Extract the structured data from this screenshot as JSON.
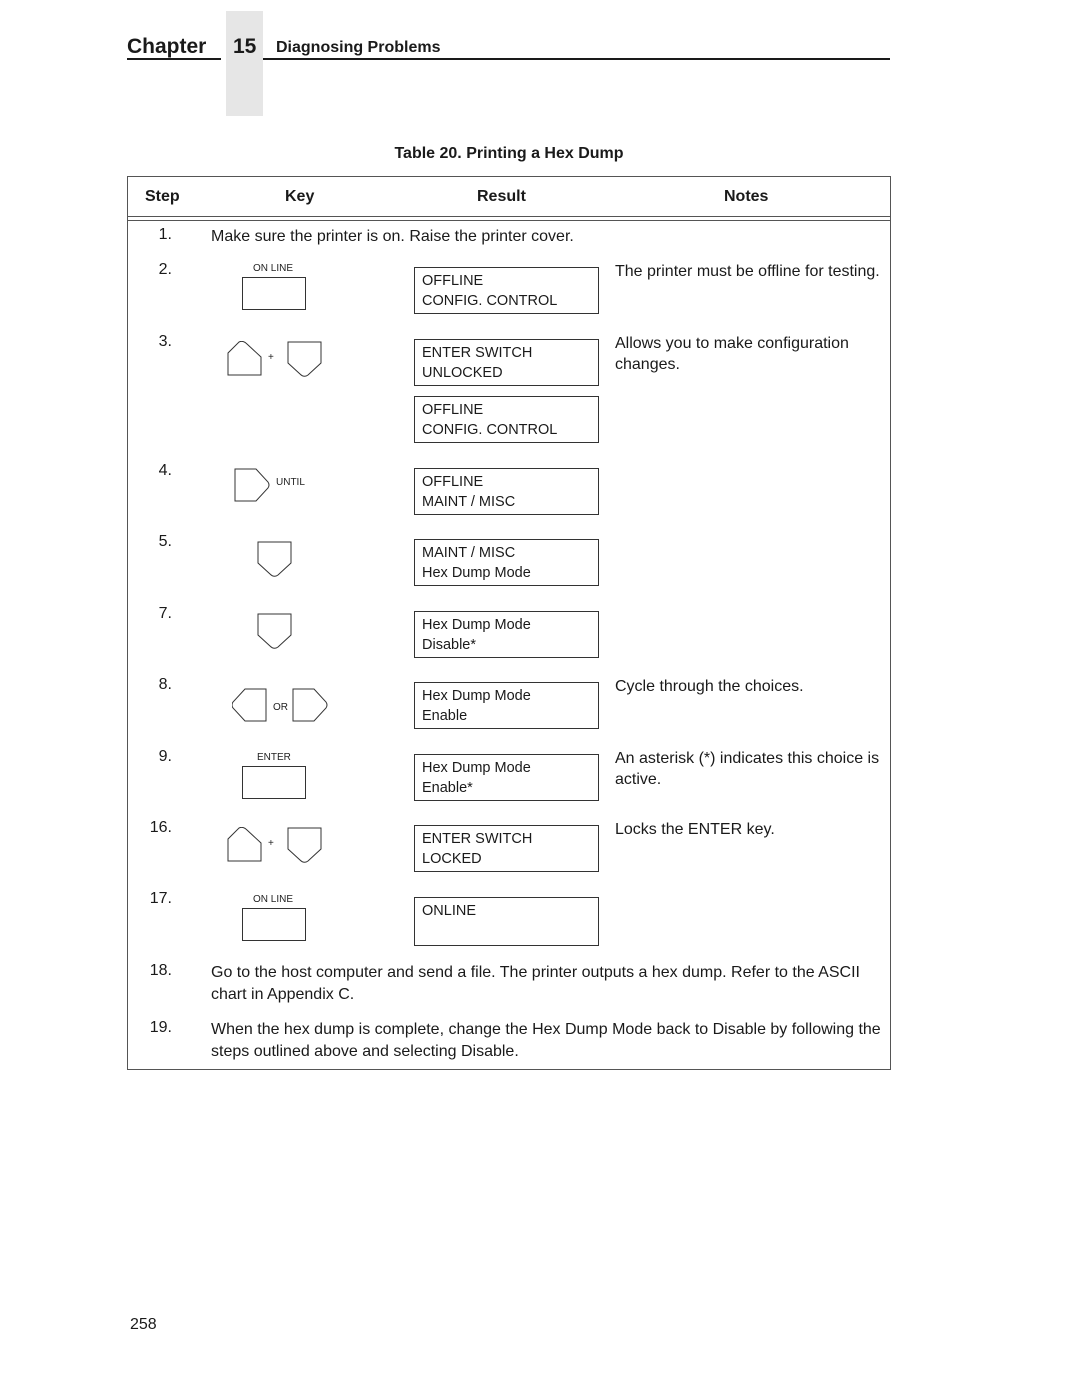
{
  "header": {
    "chapter_word": "Chapter",
    "chapter_number": "15",
    "chapter_title": "Diagnosing Problems"
  },
  "table": {
    "caption": "Table 20. Printing a Hex Dump",
    "columns": [
      "Step",
      "Key",
      "Result",
      "Notes"
    ],
    "rows": [
      {
        "step": "1.",
        "text": "Make sure the printer is on. Raise the printer cover."
      },
      {
        "step": "2.",
        "key": {
          "icon": "online-key-icon",
          "label": "ON LINE"
        },
        "display": [
          "OFFLINE",
          "CONFIG. CONTROL"
        ],
        "note": "The printer must be offline for testing."
      },
      {
        "step": "3.",
        "key": {
          "icon": "up-plus-down-keys-icon",
          "label": "+"
        },
        "display": [
          "ENTER SWITCH",
          "UNLOCKED"
        ],
        "display2": [
          "OFFLINE",
          "CONFIG. CONTROL"
        ],
        "note": "Allows you to make configuration changes."
      },
      {
        "step": "4.",
        "key": {
          "icon": "next-key-icon",
          "label": "UNTIL"
        },
        "display": [
          "OFFLINE",
          "MAINT / MISC"
        ],
        "note": ""
      },
      {
        "step": "5.",
        "key": {
          "icon": "down-key-icon",
          "label": ""
        },
        "display": [
          "MAINT / MISC",
          "Hex Dump Mode"
        ],
        "note": ""
      },
      {
        "step": "7.",
        "key": {
          "icon": "down-key-icon",
          "label": ""
        },
        "display": [
          "Hex Dump Mode",
          "Disable*"
        ],
        "note": ""
      },
      {
        "step": "8.",
        "key": {
          "icon": "prev-or-next-keys-icon",
          "label": "OR"
        },
        "display": [
          "Hex Dump Mode",
          "Enable"
        ],
        "note": "Cycle through the choices."
      },
      {
        "step": "9.",
        "key": {
          "icon": "enter-key-icon",
          "label": "ENTER"
        },
        "display": [
          "Hex Dump Mode",
          "Enable*"
        ],
        "note": "An asterisk (*) indicates this choice is active."
      },
      {
        "step": "16.",
        "key": {
          "icon": "up-plus-down-keys-icon",
          "label": "+"
        },
        "display": [
          "ENTER SWITCH",
          "LOCKED"
        ],
        "note": "Locks the ENTER key."
      },
      {
        "step": "17.",
        "key": {
          "icon": "online-key-icon",
          "label": "ON LINE"
        },
        "display": [
          "ONLINE",
          ""
        ],
        "note": ""
      },
      {
        "step": "18.",
        "text": "Go to the host computer and send a file. The printer outputs a hex dump. Refer to the ASCII chart in Appendix C."
      },
      {
        "step": "19.",
        "text": "When the hex dump is complete, change the Hex Dump Mode back to Disable by following the steps outlined above and selecting Disable."
      }
    ]
  },
  "footer": {
    "page_number": "258"
  }
}
